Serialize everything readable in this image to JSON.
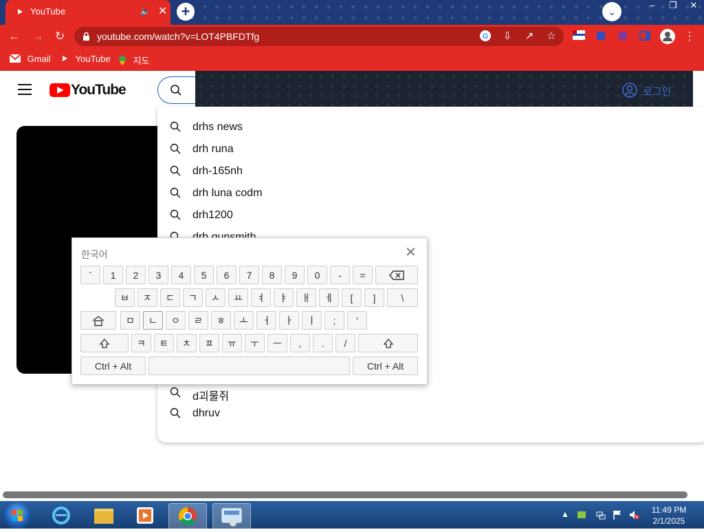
{
  "browser": {
    "tab_title": "YouTube",
    "url": "youtube.com/watch?v=LOT4PBFDTfg",
    "bookmarks": [
      "Gmail",
      "YouTube",
      "지도"
    ],
    "accent": "#e32a25"
  },
  "youtube": {
    "logo_text": "YouTube",
    "signin_label": "로그인"
  },
  "suggestions": [
    "drhs news",
    "drh runa",
    "drh-165nh",
    "drh luna codm",
    "drh1200",
    "drh gunsmith",
    "d괴물쥐",
    "dhruv"
  ],
  "keyboard": {
    "language": "한국어",
    "row1": [
      "`",
      "1",
      "2",
      "3",
      "4",
      "5",
      "6",
      "7",
      "8",
      "9",
      "0",
      "-",
      "="
    ],
    "row2": [
      "ㅂ",
      "ㅈ",
      "ㄷ",
      "ㄱ",
      "ㅅ",
      "ㅛ",
      "ㅕ",
      "ㅑ",
      "ㅐ",
      "ㅔ",
      "[",
      "]",
      "\\"
    ],
    "row3": [
      "ㅁ",
      "ㄴ",
      "ㅇ",
      "ㄹ",
      "ㅎ",
      "ㅗ",
      "ㅓ",
      "ㅏ",
      "ㅣ",
      ";",
      "'"
    ],
    "row4": [
      "ㅋ",
      "ㅌ",
      "ㅊ",
      "ㅍ",
      "ㅠ",
      "ㅜ",
      "ㅡ",
      ",",
      ".",
      "/"
    ],
    "ctrl_alt_label": "Ctrl + Alt"
  },
  "taskbar": {
    "time": "11:49 PM",
    "date": "2/1/2025"
  }
}
